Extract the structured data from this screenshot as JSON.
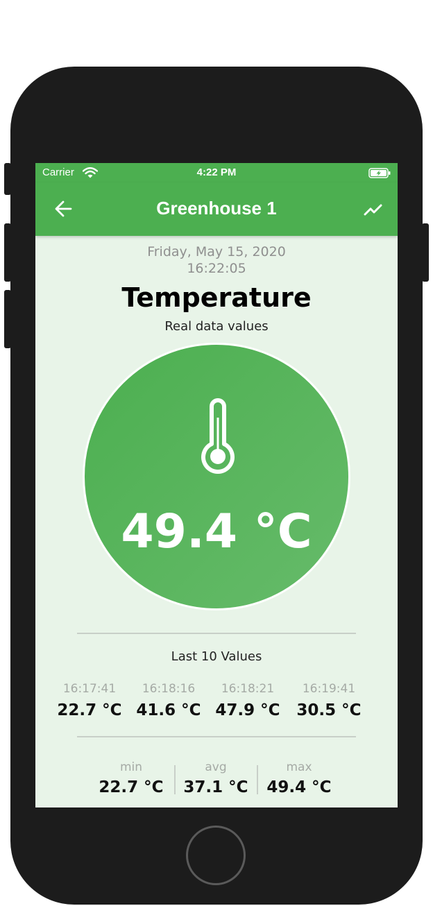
{
  "status_bar": {
    "carrier": "Carrier",
    "time": "4:22 PM"
  },
  "app_bar": {
    "title": "Greenhouse 1",
    "back_icon": "arrow-left-icon",
    "chart_icon": "trending-up-icon"
  },
  "reading": {
    "date": "Friday, May 15, 2020",
    "time": "16:22:05",
    "title": "Temperature",
    "subtitle": "Real data values",
    "value": "49.4 °C",
    "icon": "thermometer-icon"
  },
  "history": {
    "title": "Last 10 Values",
    "items": [
      {
        "time": "16:17:41",
        "value": "22.7 °C"
      },
      {
        "time": "16:18:16",
        "value": "41.6 °C"
      },
      {
        "time": "16:18:21",
        "value": "47.9 °C"
      },
      {
        "time": "16:19:41",
        "value": "30.5 °C"
      }
    ]
  },
  "stats": {
    "min_label": "min",
    "min_value": "22.7 °C",
    "avg_label": "avg",
    "avg_value": "37.1 °C",
    "max_label": "max",
    "max_value": "49.4 °C"
  },
  "colors": {
    "primary": "#4caf50",
    "background": "#e8f4e8",
    "device": "#1c1c1c"
  }
}
